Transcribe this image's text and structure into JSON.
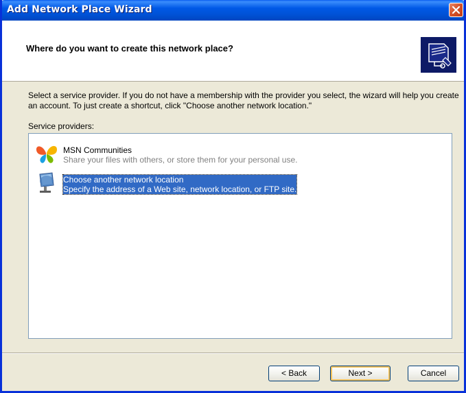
{
  "window": {
    "title": "Add Network Place Wizard"
  },
  "header": {
    "title": "Where do you want to create this network place?"
  },
  "body": {
    "description": "Select a service provider.  If you do not have a membership with the provider you select, the wizard will help you create an account.  To just create a shortcut, click \"Choose another network location.\"",
    "providers_label": "Service providers:"
  },
  "providers": [
    {
      "title": "MSN Communities",
      "description": "Share your files with others, or store them for your personal use.",
      "icon": "msn-butterfly-icon",
      "selected": false
    },
    {
      "title": "Choose another network location",
      "description": "Specify the address of a Web site, network location, or FTP site.",
      "icon": "network-location-icon",
      "selected": true
    }
  ],
  "buttons": {
    "back": "< Back",
    "next": "Next >",
    "cancel": "Cancel"
  },
  "colors": {
    "titlebar": "#0058e6",
    "selection": "#316ac5",
    "dialog_bg": "#ece9d8"
  }
}
